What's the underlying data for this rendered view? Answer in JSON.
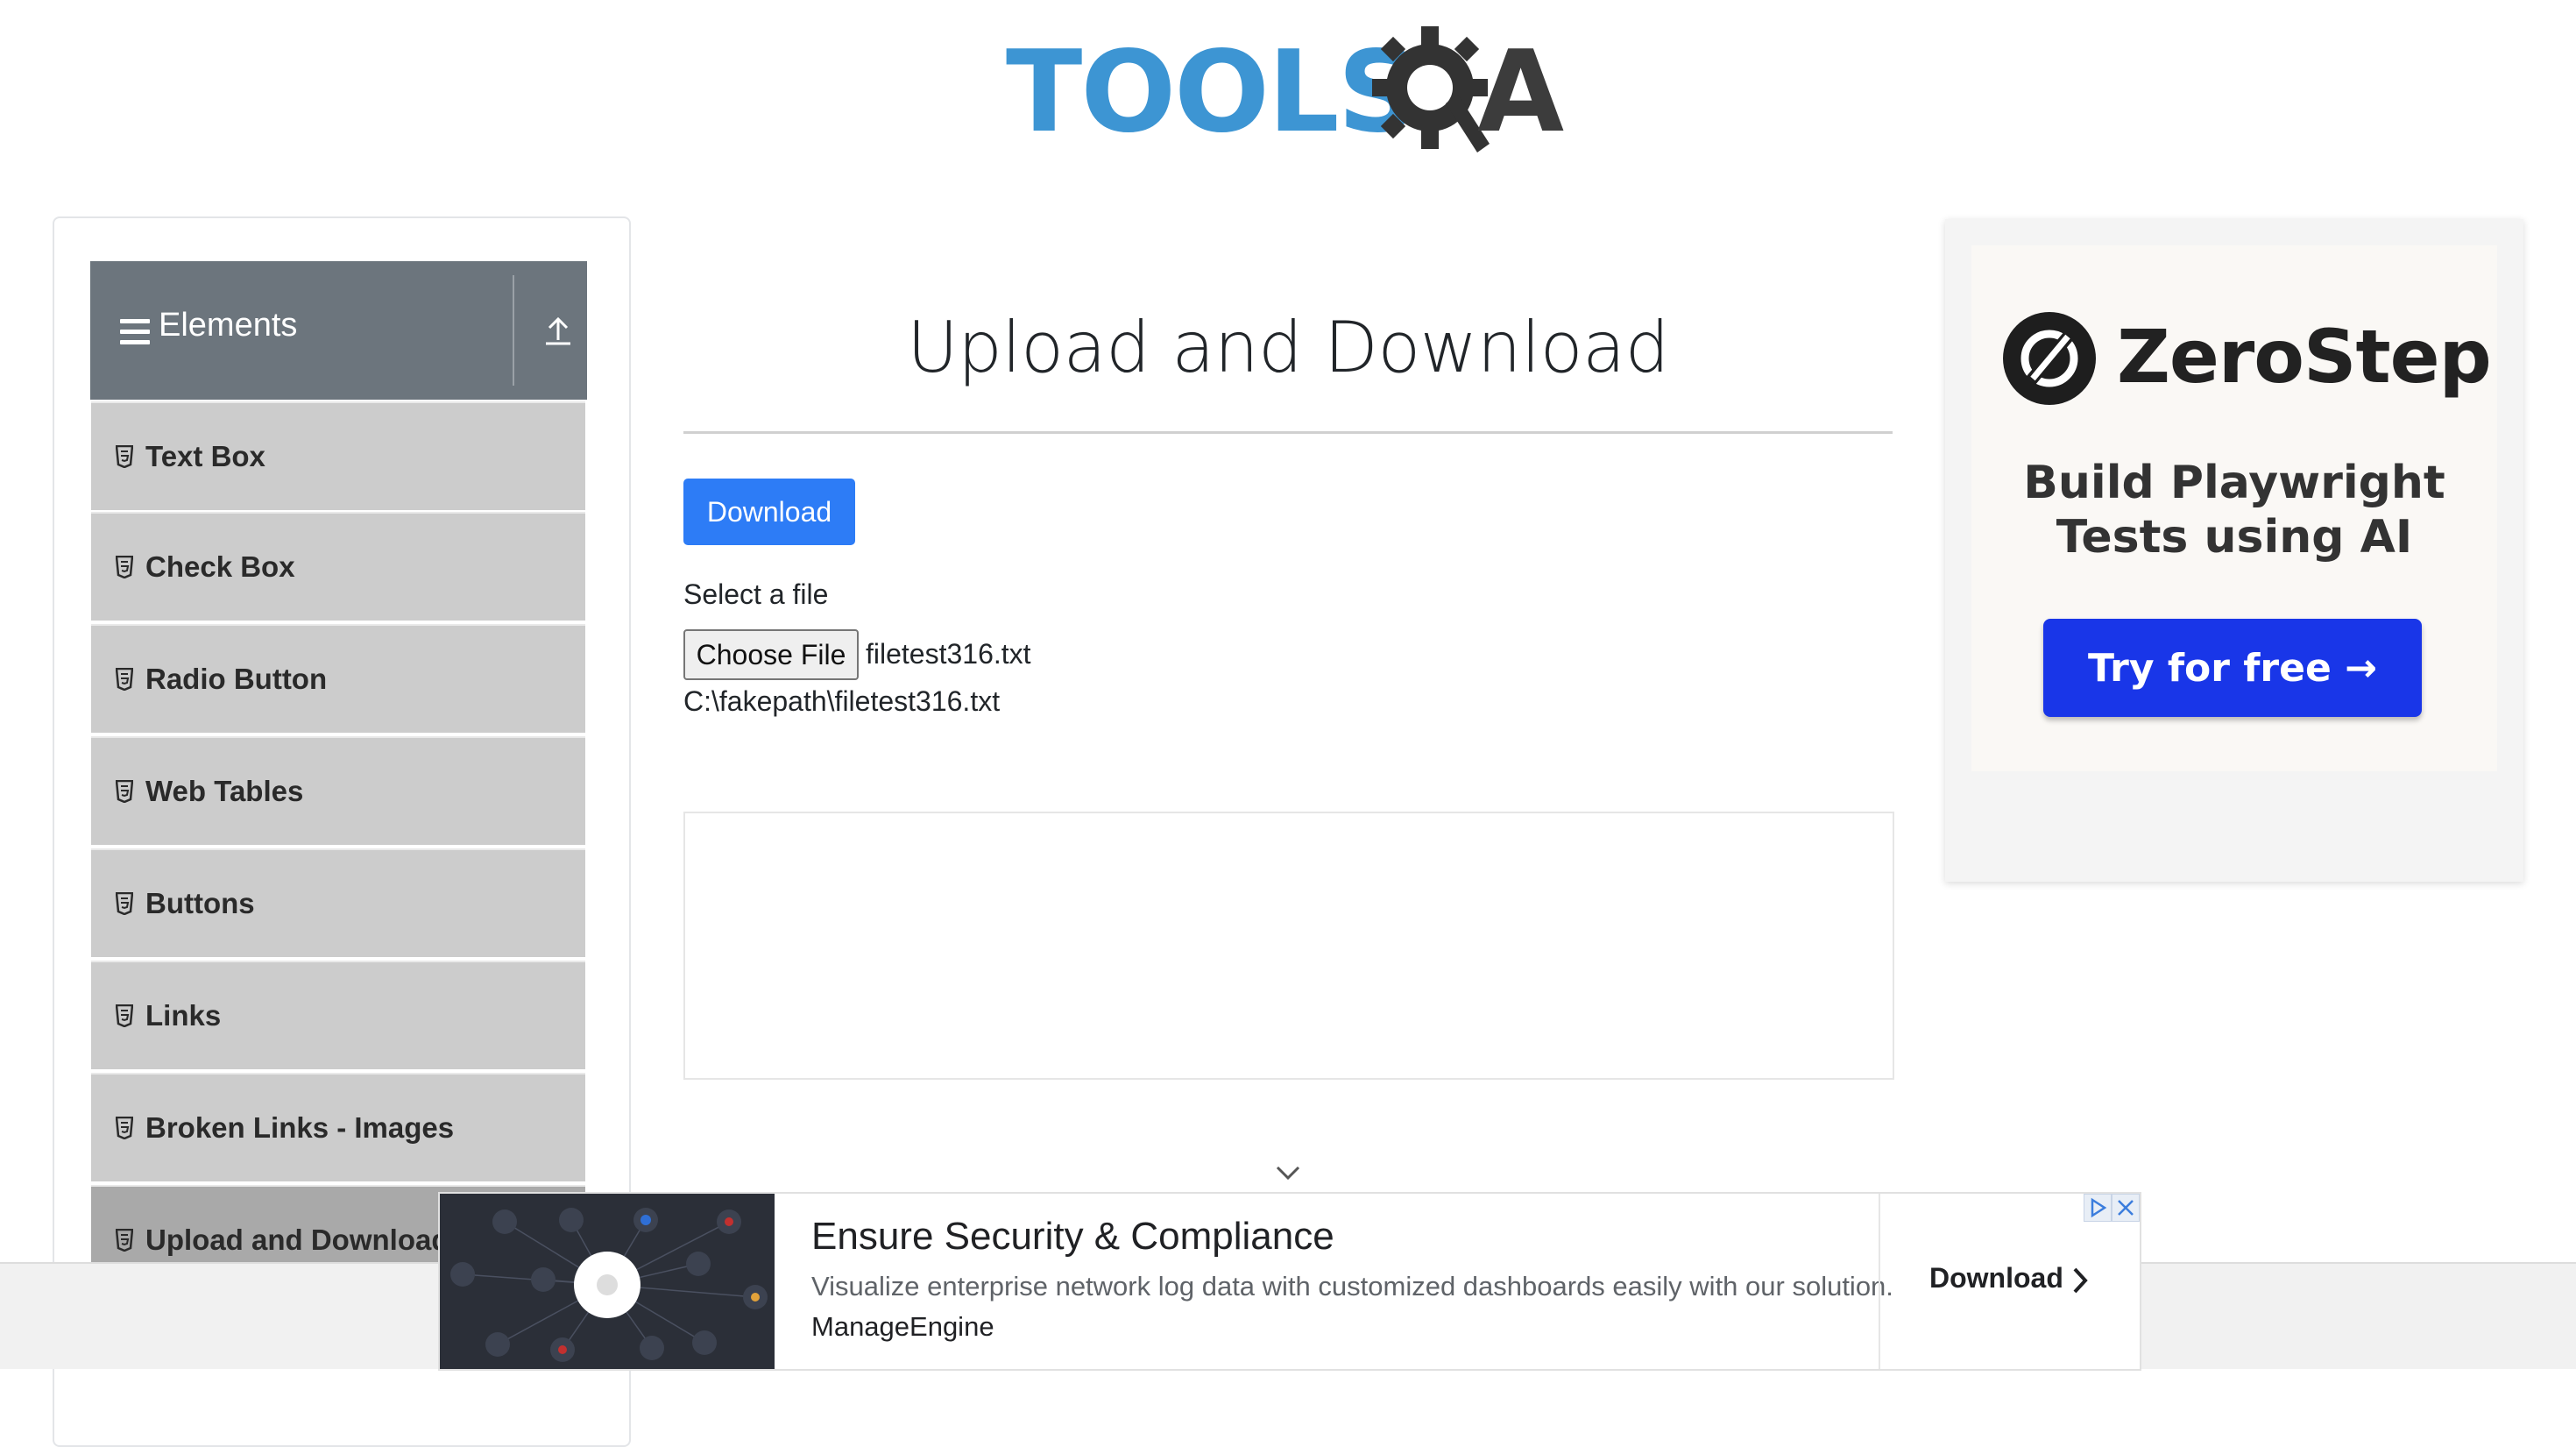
{
  "logo": {
    "word": "TOOLS",
    "a": "A"
  },
  "sidebar": {
    "group_title": "Elements",
    "items": [
      {
        "label": "Text Box"
      },
      {
        "label": "Check Box"
      },
      {
        "label": "Radio Button"
      },
      {
        "label": "Web Tables"
      },
      {
        "label": "Buttons"
      },
      {
        "label": "Links"
      },
      {
        "label": "Broken Links - Images"
      },
      {
        "label": "Upload and Download",
        "active": true
      }
    ]
  },
  "main": {
    "title": "Upload and Download",
    "download_label": "Download",
    "select_label": "Select a file",
    "choose_file_label": "Choose File",
    "chosen_file_name": "filetest316.txt",
    "uploaded_path": "C:\\fakepath\\filetest316.txt"
  },
  "ad_right": {
    "brand": "ZeroStep",
    "tagline_line1": "Build Playwright",
    "tagline_line2": "Tests using AI",
    "cta": "Try for free →",
    "cta_color": "#1936e8"
  },
  "ad_bottom": {
    "headline": "Ensure Security & Compliance",
    "description": "Visualize enterprise network log data with customized dashboards easily with our solution.",
    "advertiser": "ManageEngine",
    "cta": "Download"
  },
  "colors": {
    "primary_button": "#2d7cf6",
    "sidebar_header": "#6c757d",
    "sidebar_item": "#cccccc",
    "logo_blue": "#3d95d3"
  },
  "icons": [
    "menu-icon",
    "collapse-up-icon",
    "html5-icon",
    "zerostep-logo-icon",
    "chevron-down-icon",
    "chevron-right-icon",
    "adchoices-icon",
    "close-icon"
  ]
}
